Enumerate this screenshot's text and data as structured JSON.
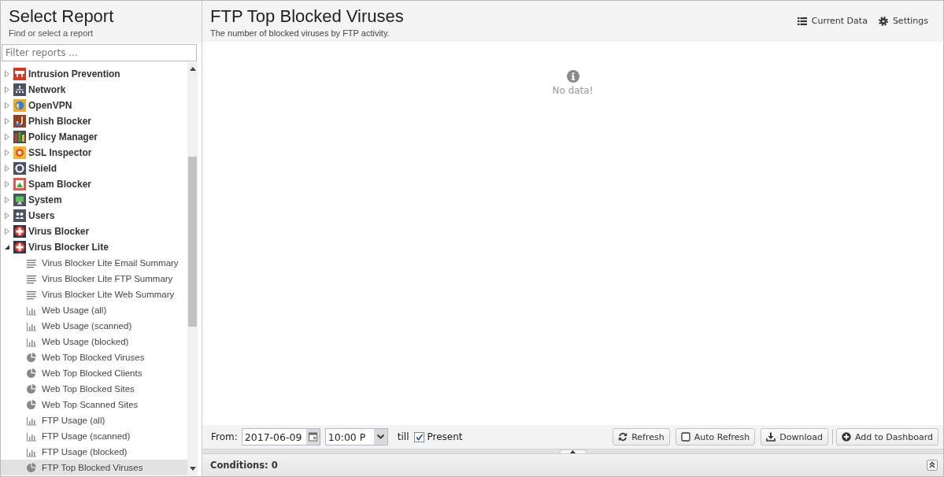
{
  "sidebar": {
    "title": "Select Report",
    "subtitle": "Find or select a report",
    "filter": {
      "placeholder": "Filter reports ..."
    },
    "tree": [
      {
        "label": "Intrusion Prevention",
        "color": "#d9361f",
        "expanded": false,
        "selected": false
      },
      {
        "label": "Network",
        "color": "#4b5263",
        "expanded": false,
        "selected": false
      },
      {
        "label": "OpenVPN",
        "color": "#f6a623",
        "expanded": false,
        "selected": false
      },
      {
        "label": "Phish Blocker",
        "color": "#93401d",
        "expanded": false,
        "selected": false
      },
      {
        "label": "Policy Manager",
        "color": "#4d4d4d",
        "expanded": false,
        "selected": false
      },
      {
        "label": "SSL Inspector",
        "color": "#f7b42c",
        "expanded": false,
        "selected": false
      },
      {
        "label": "Shield",
        "color": "#4b5263",
        "expanded": false,
        "selected": false
      },
      {
        "label": "Spam Blocker",
        "color": "#e2574c",
        "expanded": false,
        "selected": false
      },
      {
        "label": "System",
        "color": "#4b5263",
        "expanded": false,
        "selected": false
      },
      {
        "label": "Users",
        "color": "#4b5263",
        "expanded": false,
        "selected": false
      },
      {
        "label": "Virus Blocker",
        "color": "#243553",
        "expanded": false,
        "selected": false
      },
      {
        "label": "Virus Blocker Lite",
        "color": "#243553",
        "expanded": true,
        "selected": false,
        "children": [
          {
            "label": "Virus Blocker Lite Email Summary",
            "kind": "text",
            "selected": false
          },
          {
            "label": "Virus Blocker Lite FTP Summary",
            "kind": "text",
            "selected": false
          },
          {
            "label": "Virus Blocker Lite Web Summary",
            "kind": "text",
            "selected": false
          },
          {
            "label": "Web Usage (all)",
            "kind": "timeseries",
            "selected": false
          },
          {
            "label": "Web Usage (scanned)",
            "kind": "timeseries",
            "selected": false
          },
          {
            "label": "Web Usage (blocked)",
            "kind": "timeseries",
            "selected": false
          },
          {
            "label": "Web Top Blocked Viruses",
            "kind": "pie",
            "selected": false
          },
          {
            "label": "Web Top Blocked Clients",
            "kind": "pie",
            "selected": false
          },
          {
            "label": "Web Top Blocked Sites",
            "kind": "pie",
            "selected": false
          },
          {
            "label": "Web Top Scanned Sites",
            "kind": "pie",
            "selected": false
          },
          {
            "label": "FTP Usage (all)",
            "kind": "timeseries",
            "selected": false
          },
          {
            "label": "FTP Usage (scanned)",
            "kind": "timeseries",
            "selected": false
          },
          {
            "label": "FTP Usage (blocked)",
            "kind": "timeseries",
            "selected": false
          },
          {
            "label": "FTP Top Blocked Viruses",
            "kind": "pie",
            "selected": true
          }
        ]
      }
    ]
  },
  "report": {
    "title": "FTP Top Blocked Viruses",
    "subtitle": "The number of blocked viruses by FTP activity.",
    "current_data_button": "Current Data",
    "settings_button": "Settings",
    "empty_message": "No data!"
  },
  "toolbar": {
    "from_label": "From:",
    "date": "2017-06-09",
    "time": "10:00 P",
    "till_label": "till",
    "present": {
      "label": "Present",
      "checked": true
    },
    "refresh_button": "Refresh",
    "auto_refresh": {
      "label": "Auto Refresh",
      "on": false
    },
    "download_button": "Download",
    "dashboard_button": "Add to Dashboard"
  },
  "conditions": {
    "label": "Conditions: 0"
  }
}
